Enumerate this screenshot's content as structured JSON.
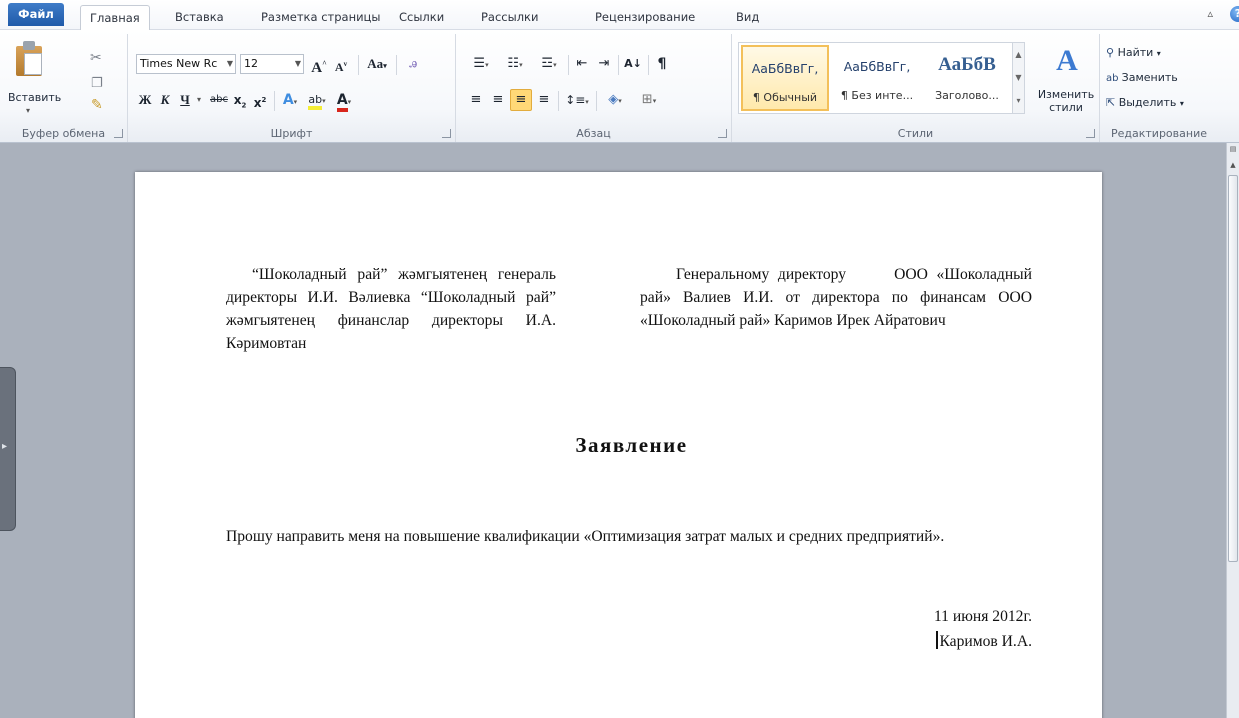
{
  "tabs": {
    "file": "Файл",
    "items": [
      "Главная",
      "Вставка",
      "Разметка страницы",
      "Ссылки",
      "Рассылки",
      "Рецензирование",
      "Вид"
    ]
  },
  "ribbon": {
    "clipboard": {
      "paste_label": "Вставить",
      "group_label": "Буфер обмена"
    },
    "font": {
      "font_name": "Times New Rc",
      "font_size": "12",
      "group_label": "Шрифт",
      "change_case": "Aa"
    },
    "paragraph": {
      "group_label": "Абзац"
    },
    "styles": {
      "group_label": "Стили",
      "change_styles_label": "Изменить стили",
      "tiles": [
        {
          "sample": "АаБбВвГг,",
          "name": "¶ Обычный"
        },
        {
          "sample": "АаБбВвГг,",
          "name": "¶ Без инте..."
        },
        {
          "sample": "АаБбВ",
          "name": "Заголово..."
        }
      ]
    },
    "editing": {
      "group_label": "Редактирование",
      "find": "Найти",
      "replace": "Заменить",
      "select": "Выделить"
    }
  },
  "document": {
    "left_block": "“Шоколадный рай” жәмгыятенең генераль директоры И.И. Вәлиевка “Шоколадный рай” жәмгыятенең финанслар директоры И.А. Кәримовтан",
    "right_block_pre": "Генеральному директору",
    "right_block_flag": "ООО",
    "right_block_post": "«Шоколадный рай» Валиев И.И. от директора по финансам ООО «Шоколадный рай» Каримов Ирек Айратович",
    "title": "Заявление",
    "body": "Прошу направить меня на повышение квалификации «Оптимизация затрат малых и средних предприятий».",
    "date": "11 июня 2012г.",
    "signature": "Каримов И.А."
  }
}
